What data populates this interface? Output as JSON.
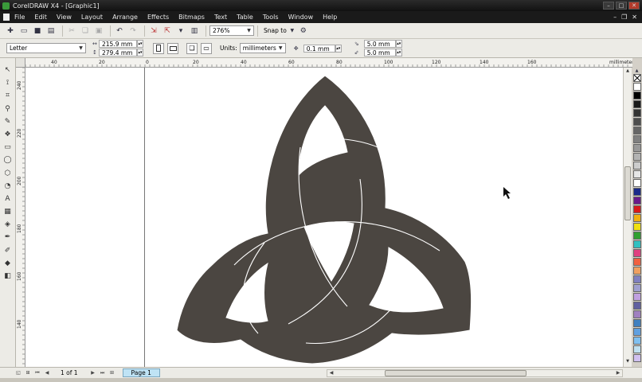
{
  "window": {
    "title": "CorelDRAW X4 - [Graphic1]"
  },
  "menu": [
    "File",
    "Edit",
    "View",
    "Layout",
    "Arrange",
    "Effects",
    "Bitmaps",
    "Text",
    "Table",
    "Tools",
    "Window",
    "Help"
  ],
  "toolbar": {
    "zoom": "276%",
    "snap_to": "Snap to"
  },
  "property_bar": {
    "paper": "Letter",
    "width": "215.9 mm",
    "height": "279.4 mm",
    "units_label": "Units:",
    "units": "millimeters",
    "nudge": "0.1 mm",
    "dup_x": "5.0 mm",
    "dup_y": "5.0 mm"
  },
  "rulers": {
    "h_ticks": [
      "40",
      "20",
      "0",
      "20",
      "40",
      "60",
      "80",
      "100",
      "120",
      "140",
      "160"
    ],
    "h_unit": "millimeters",
    "v_ticks": [
      "240",
      "220",
      "200",
      "180",
      "160",
      "140"
    ]
  },
  "navigator": {
    "page_count": "1 of 1",
    "page_tab": "Page 1"
  },
  "palette_colors": [
    "#ffffff",
    "#000000",
    "#1a1a1a",
    "#333333",
    "#4d4d4d",
    "#666666",
    "#808080",
    "#999999",
    "#b3b3b3",
    "#cccccc",
    "#e6e6e6",
    "#ffffff",
    "#1a2a8a",
    "#6a1a8a",
    "#d81a1a",
    "#f0b010",
    "#f0e010",
    "#30a030",
    "#30c0c0",
    "#e04080",
    "#f06040",
    "#f0a060",
    "#8080c0",
    "#a0a0d0",
    "#c0a0e0",
    "#6060a0",
    "#a080c0",
    "#4080c0",
    "#60a0e0",
    "#80c0f0",
    "#c0e0f0",
    "#d0c0f0"
  ]
}
